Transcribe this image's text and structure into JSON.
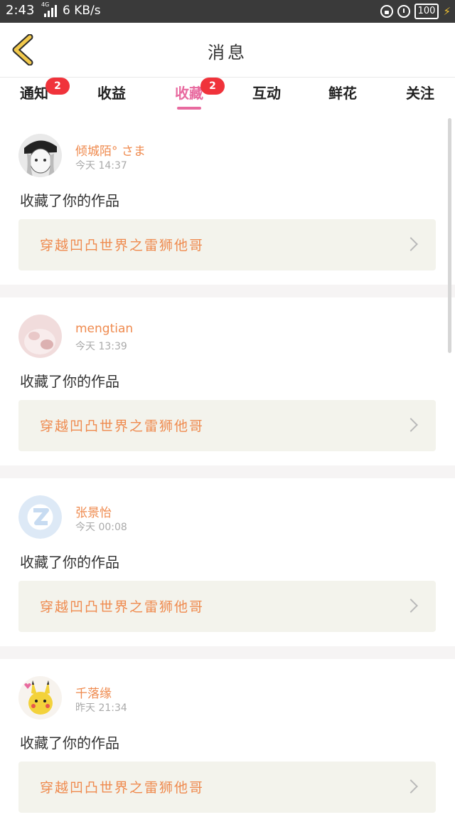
{
  "status_bar": {
    "time": "2:43",
    "network": "4G",
    "speed": "6 KB/s",
    "battery": "100"
  },
  "header": {
    "title": "消息",
    "back_icon": "chevron-left-icon"
  },
  "tabs": [
    {
      "label": "通知",
      "badge": "2",
      "active": false
    },
    {
      "label": "收益",
      "badge": "",
      "active": false
    },
    {
      "label": "收藏",
      "badge": "2",
      "active": true
    },
    {
      "label": "互动",
      "badge": "",
      "active": false
    },
    {
      "label": "鲜花",
      "badge": "",
      "active": false
    },
    {
      "label": "关注",
      "badge": "",
      "active": false
    }
  ],
  "items": [
    {
      "user": "倾城陌° さま",
      "time": "今天  14:37",
      "action": "收藏了你的作品",
      "work": "穿越凹凸世界之雷狮他哥",
      "avatar": "anime-avatar"
    },
    {
      "user": "mengtian",
      "time": "今天  13:39",
      "action": "收藏了你的作品",
      "work": "穿越凹凸世界之雷狮他哥",
      "avatar": "pink-avatar"
    },
    {
      "user": "张景怡",
      "time": "今天  00:08",
      "action": "收藏了你的作品",
      "work": "穿越凹凸世界之雷狮他哥",
      "avatar": "default-avatar"
    },
    {
      "user": "千落缘",
      "time": "昨天  21:34",
      "action": "收藏了你的作品",
      "work": "穿越凹凸世界之雷狮他哥",
      "avatar": "pikachu-avatar"
    }
  ],
  "colors": {
    "accent": "#e86a9f",
    "name": "#ef8a4e",
    "badge": "#f0333b",
    "back": "#f2c94c"
  }
}
